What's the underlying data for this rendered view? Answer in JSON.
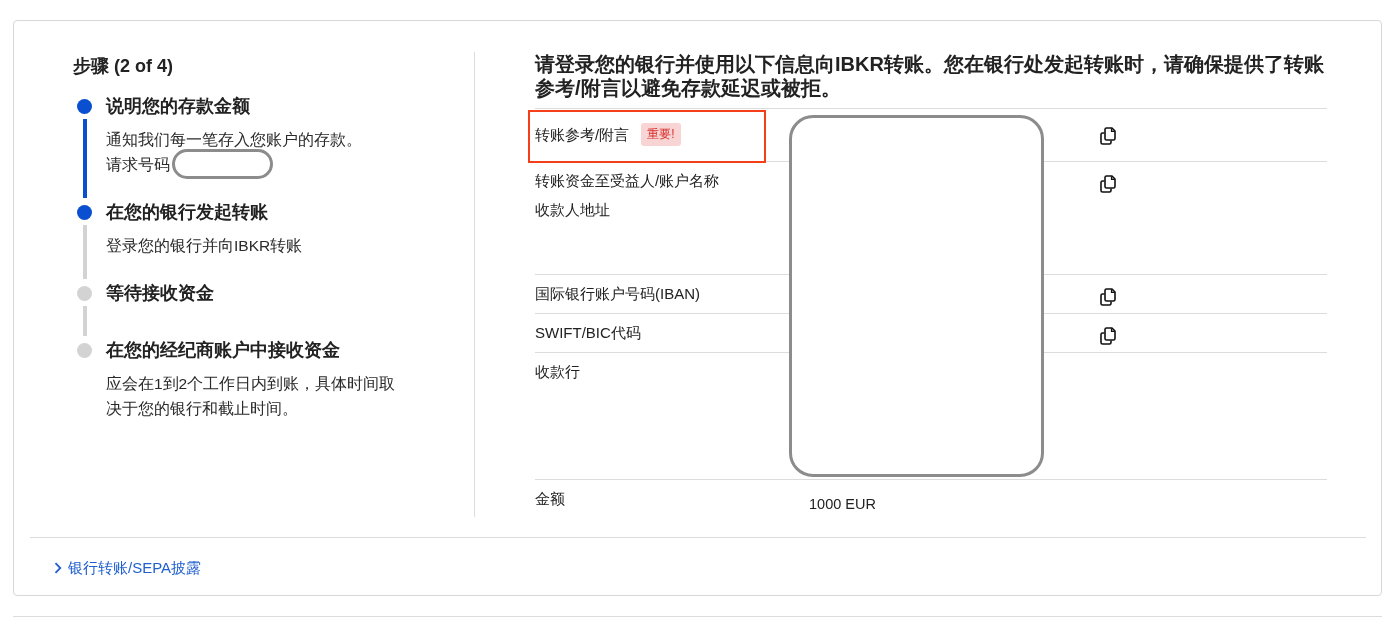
{
  "steps_panel": {
    "title": "步骤 (2 of 4)",
    "steps": [
      {
        "kind": "done",
        "title": "说明您的存款金额",
        "description": "通知我们每一笔存入您账户的存款。",
        "request_number": {
          "label": "请求号码",
          "redacted": true
        }
      },
      {
        "kind": "current",
        "title": "在您的银行发起转账",
        "description": "登录您的银行并向IBKR转账"
      },
      {
        "kind": "pending",
        "title": "等待接收资金"
      },
      {
        "kind": "pending",
        "title": "在您的经纪商账户中接收资金",
        "description": "应会在1到2个工作日内到账，具体时间取决于您的银行和截止时间。"
      }
    ]
  },
  "instructions": {
    "heading": "请登录您的银行并使用以下信息向IBKR转账。您在银行处发起转账时，请确保提供了转账参考/附言以避免存款延迟或被拒。",
    "values_redacted": true,
    "rows": [
      {
        "labels": [
          "转账参考/附言"
        ],
        "badge": "重要!",
        "highlighted": true,
        "copyable": true
      },
      {
        "labels": [
          "转账资金至受益人/账户名称",
          "收款人地址"
        ],
        "highlighted": false,
        "copyable": true
      },
      {
        "labels": [
          "国际银行账户号码(IBAN)"
        ],
        "highlighted": false,
        "copyable": true
      },
      {
        "labels": [
          "SWIFT/BIC代码"
        ],
        "highlighted": false,
        "copyable": true
      },
      {
        "labels": [
          "收款行"
        ],
        "highlighted": false,
        "copyable": false
      },
      {
        "labels": [
          "金额"
        ],
        "value": "1000 EUR",
        "highlighted": false,
        "copyable": false
      }
    ]
  },
  "disclosure_link": {
    "label": "银行转账/SEPA披露",
    "expanded": false
  }
}
